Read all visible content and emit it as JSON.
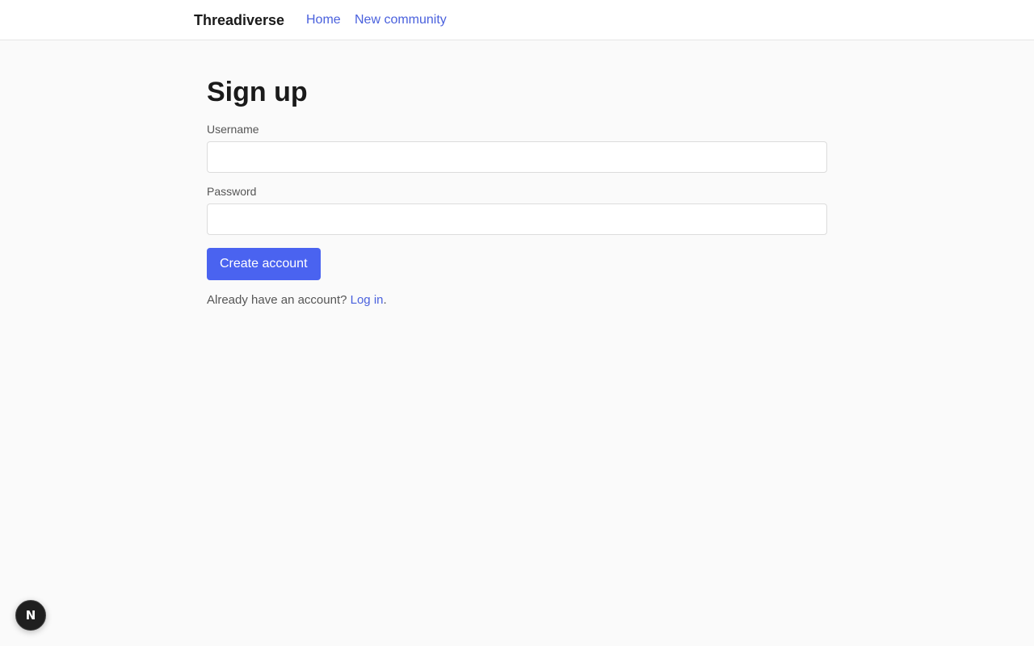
{
  "header": {
    "brand": "Threadiverse",
    "nav": [
      {
        "label": "Home"
      },
      {
        "label": "New community"
      }
    ]
  },
  "signup": {
    "title": "Sign up",
    "username_label": "Username",
    "username_value": "",
    "password_label": "Password",
    "password_value": "",
    "submit_label": "Create account",
    "login_prompt": "Already have an account?",
    "login_link": "Log in",
    "login_suffix": "."
  },
  "dev_badge": {
    "icon": "nextjs-logo-icon",
    "glyph": "N"
  },
  "colors": {
    "accent": "#4a63f0",
    "link": "#4a61dd",
    "background": "#fafafa"
  }
}
